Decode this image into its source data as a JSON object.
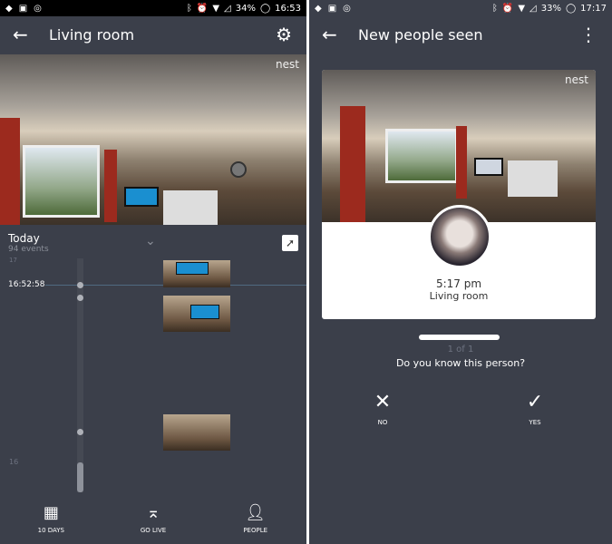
{
  "left": {
    "status": {
      "battery": "34%",
      "time": "16:53"
    },
    "title": "Living room",
    "brand": "nest",
    "today": {
      "label": "Today",
      "events": "94 events"
    },
    "timeline": {
      "current_time": "16:52:58",
      "hour_top": "17",
      "hour_bottom": "16"
    },
    "nav": [
      {
        "label": "10 DAYS",
        "icon": "calendar-icon"
      },
      {
        "label": "GO LIVE",
        "icon": "go-live-icon"
      },
      {
        "label": "PEOPLE",
        "icon": "person-icon"
      }
    ]
  },
  "right": {
    "status": {
      "battery": "33%",
      "time": "17:17"
    },
    "title": "New people seen",
    "brand": "nest",
    "card": {
      "time": "5:17 pm",
      "location": "Living room"
    },
    "progress": 1.0,
    "count": "1 of 1",
    "question": "Do you know this person?",
    "no_label": "NO",
    "yes_label": "YES"
  },
  "colors": {
    "background": "#3b3f4a",
    "card": "#ffffff"
  }
}
